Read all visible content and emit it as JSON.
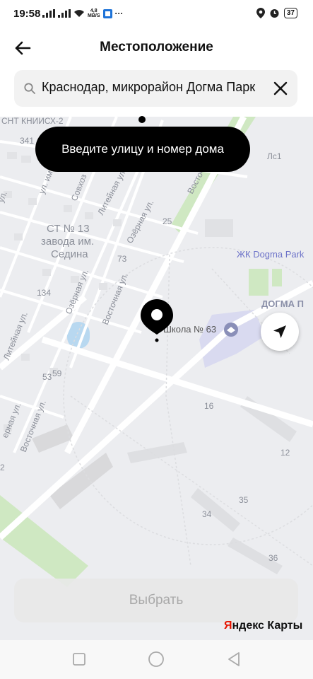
{
  "status_bar": {
    "time": "19:58",
    "net_speed_value": "4,8",
    "net_speed_unit": "MB/S",
    "battery": "37",
    "more": "···"
  },
  "header": {
    "title": "Местоположение",
    "back_icon": "arrow-left-icon"
  },
  "search": {
    "value": "Краснодар, микрорайон Догма Парк",
    "icon": "search-icon",
    "clear_icon": "close-icon"
  },
  "tooltip": {
    "text": "Введите улицу и номер дома"
  },
  "map": {
    "labels": {
      "snt": "СНТ КНИИСХ-2",
      "n341": "341",
      "ul": "ул.",
      "ul_im": "ул. им.",
      "sovkhoz": "Совхоз",
      "liteynaya_top": "Литейная ул.",
      "ozernaya_top": "Озёрная ул.",
      "vostoch_top": "Восточ",
      "ic1": "Лс1",
      "st13_line1": "СТ № 13",
      "st13_line2": "завода им.",
      "st13_line3": "Седина",
      "n25": "25",
      "n73": "73",
      "n134": "134",
      "ozernaya_mid": "Озёрная ул.",
      "vostochnaya_mid": "Восточная ул.",
      "liteynaya_mid": "Литейная ул.",
      "n59": "59",
      "n53": "53",
      "ernaya": "ерная ул.",
      "vostochnaya_bot": "Восточная ул.",
      "zhk": "ЖК Dogma Park",
      "dogma": "ДОГМА П",
      "school": "Школа № 63",
      "n16": "16",
      "n12": "12",
      "n35": "35",
      "n34": "34",
      "n36": "36",
      "n2": "2"
    },
    "colors": {
      "background": "#ecedf0",
      "road": "#ffffff",
      "green": "#cfe8c2",
      "label": "#8b8f99",
      "poi": "#6d73c9"
    }
  },
  "actions": {
    "select_label": "Выбрать"
  },
  "attribution": {
    "y": "Я",
    "rest": "ндекс Карты"
  },
  "nav": {
    "recent_icon": "square-icon",
    "home_icon": "circle-icon",
    "back_icon": "triangle-back-icon"
  }
}
